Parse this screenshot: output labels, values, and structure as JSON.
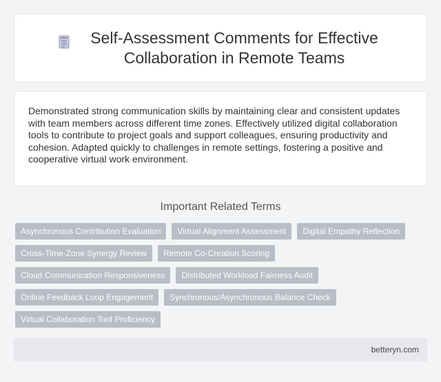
{
  "header": {
    "icon": "document-icon",
    "title": "Self-Assessment Comments for Effective Collaboration in Remote Teams"
  },
  "summary": {
    "text": "Demonstrated strong communication skills by maintaining clear and consistent updates with team members across different time zones. Effectively utilized digital collaboration tools to contribute to project goals and support colleagues, ensuring productivity and cohesion. Adapted quickly to challenges in remote settings, fostering a positive and cooperative virtual work environment."
  },
  "related": {
    "heading": "Important Related Terms",
    "terms": [
      "Asynchronous Contribution Evaluation",
      "Virtual Alignment Assessment",
      "Digital Empathy Reflection",
      "Cross-Time-Zone Synergy Review",
      "Remote Co-Creation Scoring",
      "Cloud Communication Responsiveness",
      "Distributed Workload Fairness Audit",
      "Online Feedback Loop Engagement",
      "Synchronous/Asynchronous Balance Check",
      "Virtual Collaboration Tool Proficiency"
    ]
  },
  "footer": {
    "site": "betteryn.com"
  },
  "colors": {
    "tag_background": "#b8bec5",
    "footer_background": "#e6e8ee",
    "page_background": "#f3f4f6"
  }
}
